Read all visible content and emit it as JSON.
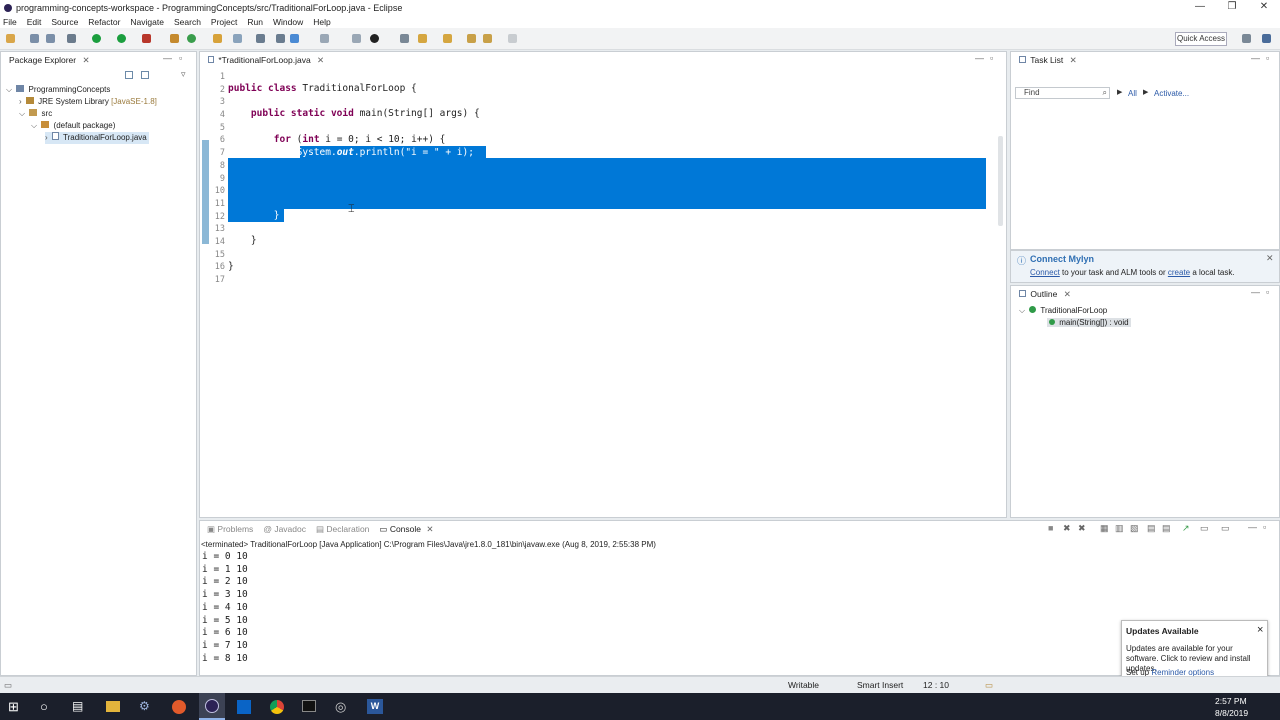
{
  "window": {
    "title": "programming-concepts-workspace - ProgrammingConcepts/src/TraditionalForLoop.java - Eclipse"
  },
  "menu": [
    "File",
    "Edit",
    "Source",
    "Refactor",
    "Navigate",
    "Search",
    "Project",
    "Run",
    "Window",
    "Help"
  ],
  "toolbar": {
    "quick_access": "Quick Access"
  },
  "package_explorer": {
    "tab": "Package Explorer",
    "items": {
      "project": "ProgrammingConcepts",
      "jre": "JRE System Library",
      "jre_version": "[JavaSE-1.8]",
      "src": "src",
      "pkg": "(default package)",
      "file": "TraditionalForLoop.java"
    }
  },
  "editor": {
    "tab": "*TraditionalForLoop.java",
    "line_numbers": [
      "1",
      "2",
      "3",
      "4",
      "5",
      "6",
      "7",
      "8",
      "9",
      "10",
      "11",
      "12",
      "13",
      "14",
      "15",
      "16",
      "17"
    ]
  },
  "task_list": {
    "tab": "Task List",
    "find_placeholder": "Find",
    "all": "All",
    "activate": "Activate..."
  },
  "mylyn": {
    "title": "Connect Mylyn",
    "connect": "Connect",
    "text1": "to your task and ALM tools or",
    "create": "create",
    "text2": "a local task."
  },
  "outline": {
    "tab": "Outline",
    "class": "TraditionalForLoop",
    "method": "main(String[]) : void"
  },
  "bottom_tabs": {
    "problems": "Problems",
    "javadoc": "Javadoc",
    "declaration": "Declaration",
    "console": "Console"
  },
  "console": {
    "header": "<terminated> TraditionalForLoop [Java Application] C:\\Program Files\\Java\\jre1.8.0_181\\bin\\javaw.exe (Aug 8, 2019, 2:55:38 PM)",
    "lines": [
      "i = 0 10",
      "i = 1 10",
      "i = 2 10",
      "i = 3 10",
      "i = 4 10",
      "i = 5 10",
      "i = 6 10",
      "i = 7 10",
      "i = 8 10"
    ]
  },
  "status": {
    "writable": "Writable",
    "insert": "Smart Insert",
    "position": "12 : 10"
  },
  "updates_popup": {
    "title": "Updates Available",
    "body": "Updates are available for your software. Click to review and install updates.",
    "setup": "Set up",
    "link": "Reminder options",
    "close": "×"
  },
  "taskbar": {
    "time": "2:57 PM",
    "date": "8/8/2019"
  }
}
